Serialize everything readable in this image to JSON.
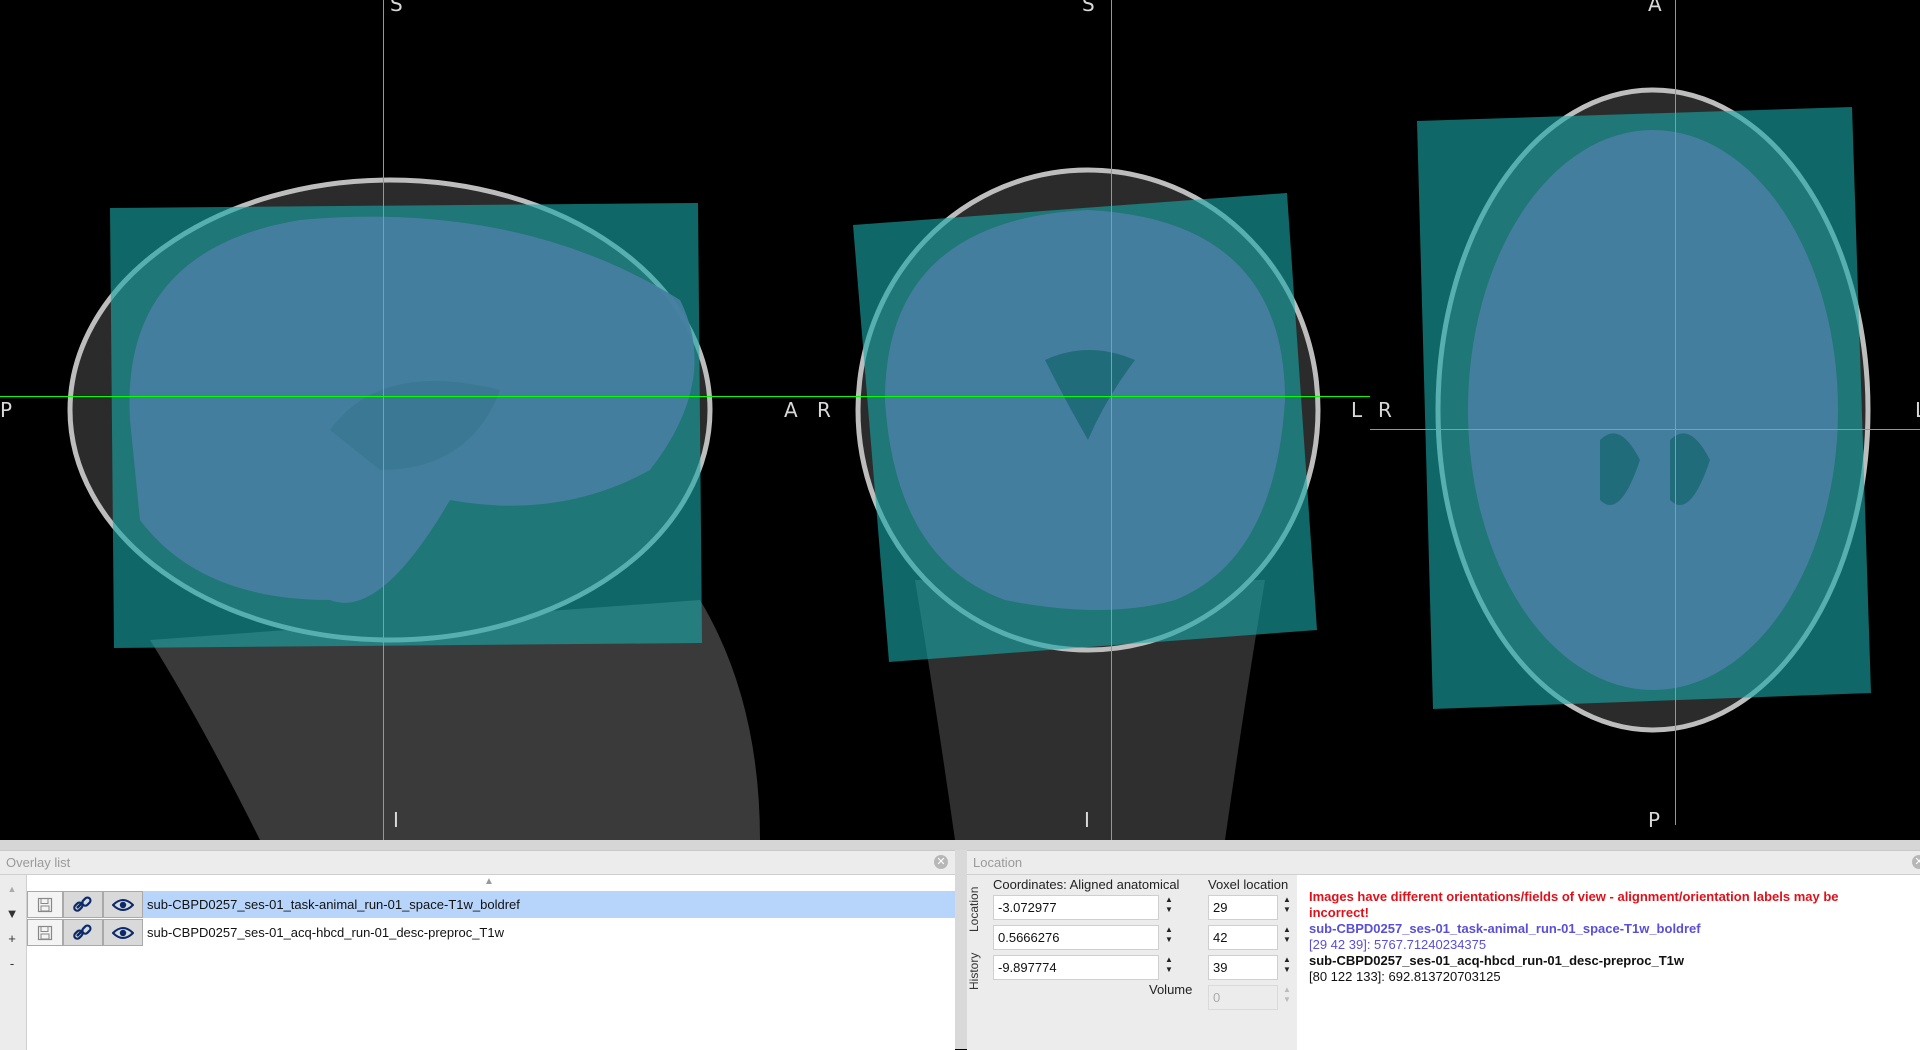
{
  "views": {
    "sagittal": {
      "top": "S",
      "bottom": "I",
      "left": "P",
      "right": "A"
    },
    "coronal": {
      "top": "S",
      "bottom": "I",
      "left": "R",
      "right": "L"
    },
    "axial": {
      "top": "A",
      "bottom": "P",
      "left": "R",
      "right": "L"
    }
  },
  "colors": {
    "crosshair": "#00ff00",
    "overlay": "#1aa6a6",
    "brain": "#8d3f98",
    "selection": "#b7d5fb",
    "warning": "#e0101a",
    "info_blue": "#5a4fd6"
  },
  "overlay_panel": {
    "title": "Overlay list",
    "toolbar": {
      "up": "▲",
      "down": "▼",
      "add": "+",
      "remove": "-"
    },
    "items": [
      {
        "name": "sub-CBPD0257_ses-01_task-animal_run-01_space-T1w_boldref",
        "selected": true
      },
      {
        "name": "sub-CBPD0257_ses-01_acq-hbcd_run-01_desc-preproc_T1w",
        "selected": false
      }
    ]
  },
  "location_panel": {
    "title": "Location",
    "tabs": {
      "location": "Location",
      "history": "History"
    },
    "coords_header": "Coordinates: Aligned anatomical",
    "voxel_header": "Voxel location",
    "coords": [
      "-3.072977",
      "0.5666276",
      "-9.897774"
    ],
    "voxels": [
      "29",
      "42",
      "39"
    ],
    "volume_label": "Volume",
    "volume_value": "0",
    "warning_line1": "Images have different orientations/fields of view - alignment/orientation labels may be",
    "warning_line2": "incorrect!",
    "image1_name": "sub-CBPD0257_ses-01_task-animal_run-01_space-T1w_boldref",
    "image1_value": "[29 42 39]: 5767.71240234375",
    "image2_name": "sub-CBPD0257_ses-01_acq-hbcd_run-01_desc-preproc_T1w",
    "image2_value": "[80 122 133]: 692.813720703125"
  }
}
